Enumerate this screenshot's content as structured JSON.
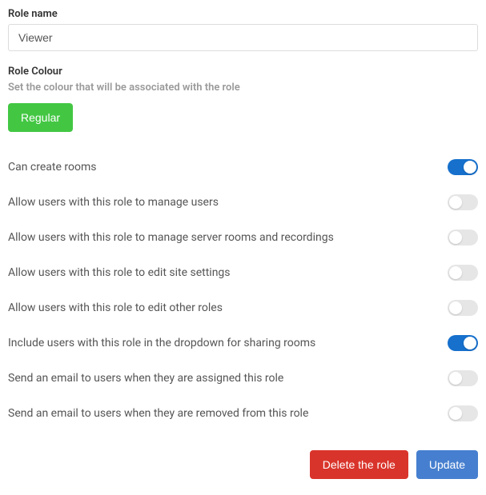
{
  "role_name": {
    "label": "Role name",
    "value": "Viewer"
  },
  "role_colour": {
    "label": "Role Colour",
    "help": "Set the colour that will be associated with the role",
    "button_label": "Regular",
    "button_color": "#43c743"
  },
  "permissions": [
    {
      "label": "Can create rooms",
      "enabled": true
    },
    {
      "label": "Allow users with this role to manage users",
      "enabled": false
    },
    {
      "label": "Allow users with this role to manage server rooms and recordings",
      "enabled": false
    },
    {
      "label": "Allow users with this role to edit site settings",
      "enabled": false
    },
    {
      "label": "Allow users with this role to edit other roles",
      "enabled": false
    },
    {
      "label": "Include users with this role in the dropdown for sharing rooms",
      "enabled": true
    },
    {
      "label": "Send an email to users when they are assigned this role",
      "enabled": false
    },
    {
      "label": "Send an email to users when they are removed from this role",
      "enabled": false
    }
  ],
  "actions": {
    "delete_label": "Delete the role",
    "update_label": "Update"
  }
}
